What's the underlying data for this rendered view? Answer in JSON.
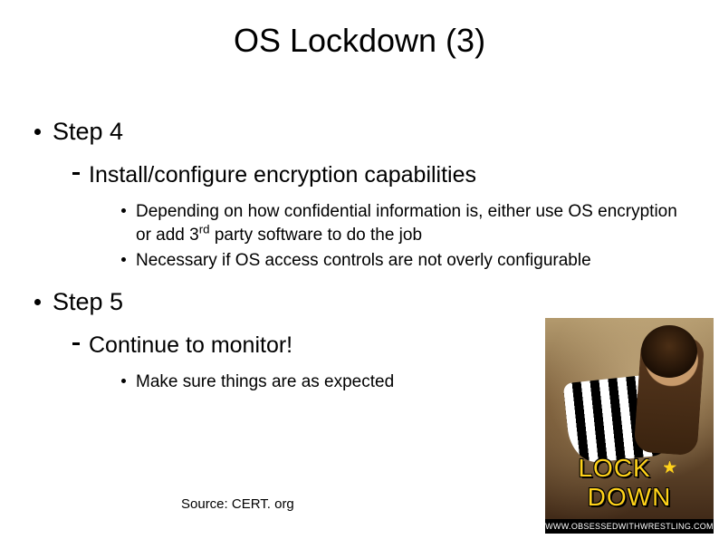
{
  "title": "OS Lockdown (3)",
  "items": [
    {
      "label": "Step 4",
      "children": [
        {
          "label": "Install/configure encryption capabilities",
          "children": [
            {
              "label_html": "Depending on how confidential information is, either use OS encryption or add 3<sup>rd</sup> party software to do the job"
            },
            {
              "label": "Necessary if OS access controls are not overly configurable"
            }
          ]
        }
      ]
    },
    {
      "label": "Step 5",
      "children": [
        {
          "label": "Continue to monitor!",
          "children": [
            {
              "label": "Make sure things are as expected"
            }
          ]
        }
      ]
    }
  ],
  "source": "Source: CERT. org",
  "figure": {
    "lock": "LOCK",
    "down": "DOWN",
    "watermark": "WWW.OBSESSEDWITHWRESTLING.COM"
  }
}
